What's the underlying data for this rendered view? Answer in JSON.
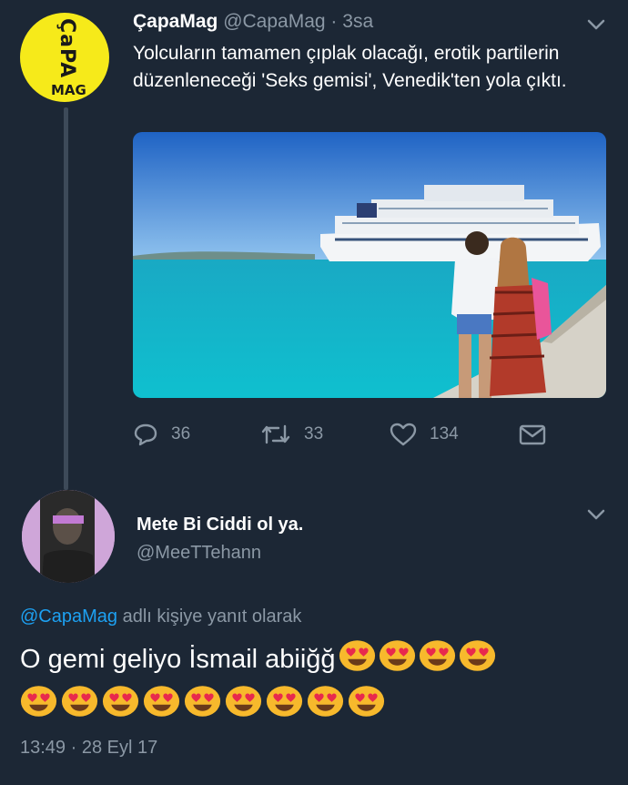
{
  "tweet": {
    "author_name": "ÇapaMag",
    "author_handle": "@CapaMag",
    "separator": "·",
    "time": "3sa",
    "avatar_text_vertical": "ÇaPA",
    "avatar_text_bottom": "MAG",
    "text": "Yolcuların tamamen çıplak olacağı, erotik partilerin düzenleneceği 'Seks gemisi', Venedik'ten yola çıktı.",
    "actions": {
      "reply_count": "36",
      "retweet_count": "33",
      "like_count": "134"
    }
  },
  "reply": {
    "author_name": "Mete Bi Ciddi ol ya.",
    "author_handle": "@MeeTTehann",
    "reply_to_mention": "@CapaMag",
    "reply_to_suffix": " adlı kişiye yanıt olarak",
    "text": "O gemi geliyo İsmail abiiğğ",
    "emoji_inline_count": 4,
    "emoji_second_row_count": 9,
    "emoji_name": "heart-eyes-emoji",
    "timestamp": "13:49 · 28 Eyl 17"
  },
  "colors": {
    "background": "#1c2735",
    "secondary_text": "#8b98a5",
    "link": "#1da1f2",
    "capa_yellow": "#f6ea1a"
  }
}
